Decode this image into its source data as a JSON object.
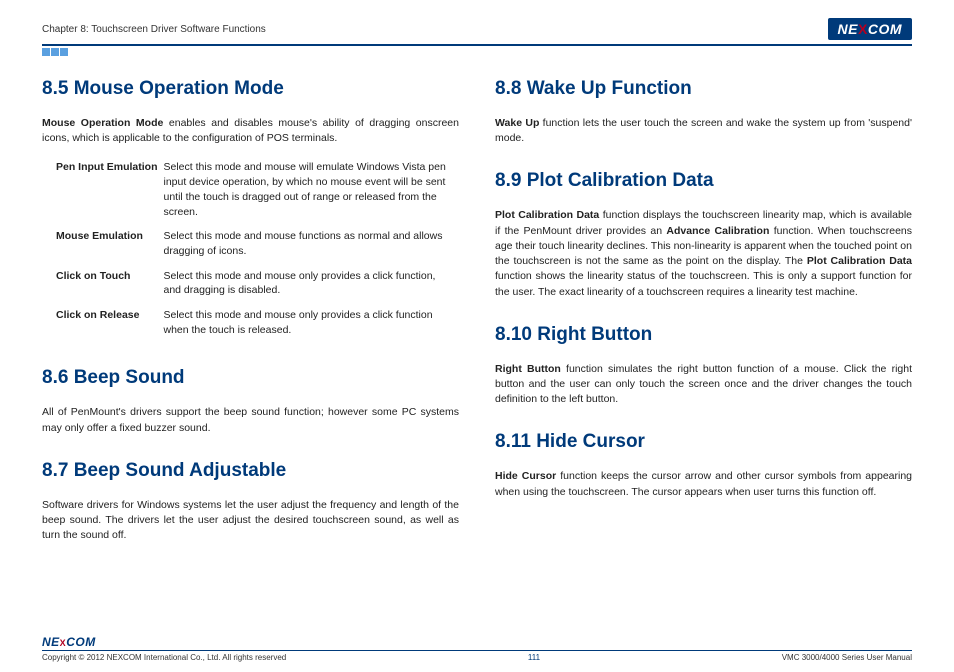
{
  "header": {
    "chapter": "Chapter 8: Touchscreen Driver Software Functions",
    "logo_pre": "NE",
    "logo_x": "X",
    "logo_post": "COM"
  },
  "left": {
    "s85": {
      "heading": "8.5  Mouse Operation Mode",
      "intro_bold": "Mouse Operation Mode",
      "intro_rest": " enables and disables mouse's ability of dragging onscreen icons, which is applicable to the configuration of POS terminals.",
      "rows": [
        {
          "label": "Pen Input Emulation",
          "desc": "Select this mode and mouse will emulate Windows Vista pen input device operation, by which no mouse event will be sent until the touch is dragged out of range or released from the screen."
        },
        {
          "label": "Mouse Emulation",
          "desc": "Select this mode and mouse functions as normal and allows dragging of icons."
        },
        {
          "label": "Click on Touch",
          "desc": "Select this mode and mouse only provides a click function, and dragging is disabled."
        },
        {
          "label": "Click on Release",
          "desc": "Select this mode and mouse only provides a click function when the touch is released."
        }
      ]
    },
    "s86": {
      "heading": "8.6  Beep Sound",
      "body": "All of PenMount's drivers support the beep sound function; however some PC systems may only offer a fixed buzzer sound."
    },
    "s87": {
      "heading": "8.7  Beep Sound Adjustable",
      "body": "Software drivers for Windows systems let the user adjust the frequency and length of the beep sound. The drivers let the user adjust the desired touchscreen sound, as well as turn the sound off."
    }
  },
  "right": {
    "s88": {
      "heading": "8.8  Wake Up Function",
      "body_bold": "Wake Up",
      "body_rest": " function lets the user touch the screen and wake the system up from 'suspend' mode."
    },
    "s89": {
      "heading": "8.9  Plot Calibration Data",
      "b1": "Plot Calibration Data",
      "t1": " function displays the touchscreen linearity map, which is available if the PenMount driver provides an ",
      "b2": "Advance Calibration",
      "t2": " function. When touchscreens age their touch linearity declines. This non-linearity is apparent when the touched point on the touchscreen is not the same as the point on the display. The ",
      "b3": "Plot Calibration Data",
      "t3": " function shows the linearity status of the touchscreen. This is only a support function for the user. The exact linearity of a touchscreen requires a linearity test machine."
    },
    "s810": {
      "heading": "8.10  Right Button",
      "body_bold": "Right Button",
      "body_rest": " function simulates the right button function of a mouse. Click the right button and the user can only touch the screen once and the driver changes the touch definition to the left button."
    },
    "s811": {
      "heading": "8.11  Hide Cursor",
      "body_bold": "Hide Cursor",
      "body_rest": " function keeps the cursor arrow and other cursor symbols from appearing when using the touchscreen. The cursor appears when user turns this function off."
    }
  },
  "footer": {
    "logo_pre": "NE",
    "logo_x": "X",
    "logo_post": "COM",
    "copyright": "Copyright © 2012 NEXCOM International Co., Ltd. All rights reserved",
    "page": "111",
    "manual": "VMC 3000/4000 Series User Manual"
  }
}
